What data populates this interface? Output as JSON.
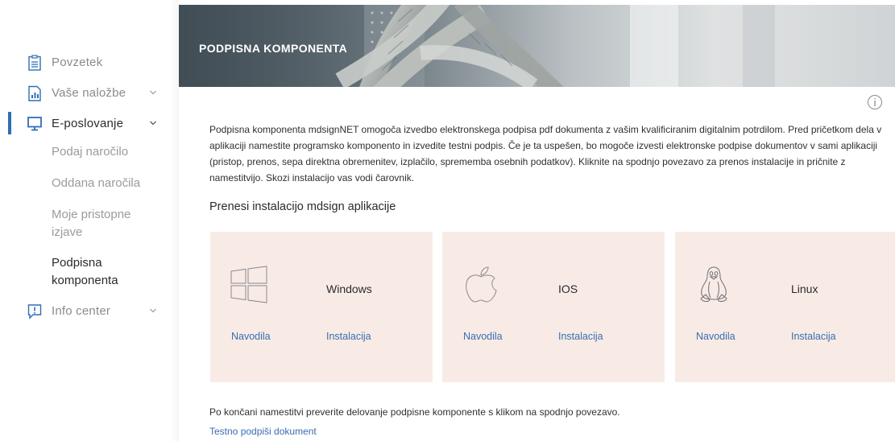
{
  "sidebar": {
    "items": [
      {
        "label": "Povzetek",
        "icon": "summary-clipboard-icon"
      },
      {
        "label": "Vaše naložbe",
        "icon": "investments-chart-icon"
      },
      {
        "label": "E-poslovanje",
        "icon": "monitor-icon"
      },
      {
        "label": "Info center",
        "icon": "info-alert-icon"
      }
    ],
    "submenu": [
      {
        "label": "Podaj naročilo"
      },
      {
        "label": "Oddana naročila"
      },
      {
        "label": "Moje pristopne izjave"
      },
      {
        "label": "Podpisna komponenta"
      }
    ],
    "accent_color": "#2f6fb4"
  },
  "hero": {
    "title": "PODPISNA KOMPONENTA"
  },
  "main": {
    "intro": "Podpisna komponenta mdsignNET omogoča izvedbo elektronskega podpisa pdf dokumenta z vašim kvalificiranim digitalnim potrdilom. Pred pričetkom dela v aplikaciji namestite programsko komponento in izvedite testni podpis. Če je ta uspešen, bo mogoče izvesti elektronske podpise dokumentov v sami aplikaciji (pristop, prenos, sepa direktna obremenitev, izplačilo, sprememba osebnih podatkov). Kliknite na spodnjo povezavo za prenos instalacije in pričnite z namestitvijo. Skozi instalacijo vas vodi čarovnik.",
    "section_title": "Prenesi instalacijo mdsign aplikacije",
    "cards": [
      {
        "os": "Windows",
        "icon": "windows-icon",
        "guide": "Navodila",
        "install": "Instalacija"
      },
      {
        "os": "IOS",
        "icon": "apple-icon",
        "guide": "Navodila",
        "install": "Instalacija"
      },
      {
        "os": "Linux",
        "icon": "linux-penguin-icon",
        "guide": "Navodila",
        "install": "Instalacija"
      }
    ],
    "card_color": "#f8ebe6",
    "link_color": "#3a6db0",
    "footer_text": "Po končani namestitvi preverite delovanje podpisne komponente s klikom na spodnjo povezavo.",
    "footer_link": "Testno podpiši dokument"
  }
}
